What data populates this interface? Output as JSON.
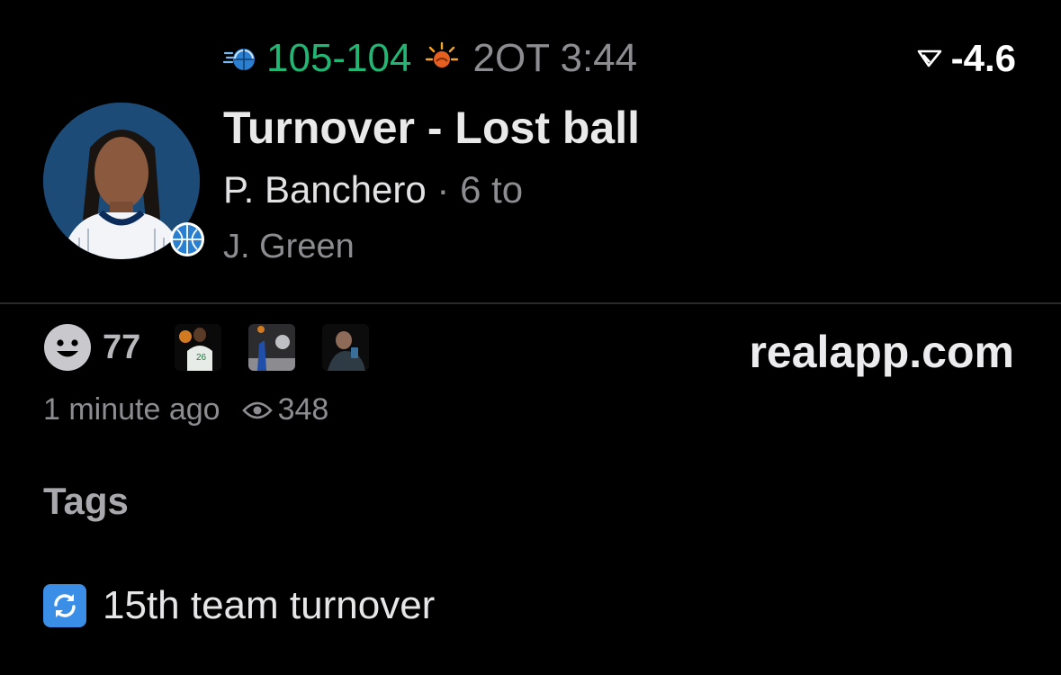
{
  "game": {
    "home_logo": "orlando-magic-logo",
    "score": "105-104",
    "away_logo": "phoenix-suns-logo",
    "clock": "2OT 3:44",
    "spread_icon": "spread-arrow-icon",
    "spread": "-4.6"
  },
  "play": {
    "title": "Turnover - Lost ball",
    "player": "P. Banchero",
    "separator": " · ",
    "count": "6 to",
    "secondary": "J. Green"
  },
  "reactions": {
    "icon": "smiley-icon",
    "count": "77",
    "thumbs": [
      "reaction-thumb-celtics-player",
      "reaction-thumb-shooting-player",
      "reaction-thumb-person-phone"
    ]
  },
  "site": "realapp.com",
  "meta": {
    "time": "1 minute ago",
    "views": "348"
  },
  "tags": {
    "heading": "Tags",
    "items": [
      {
        "icon": "repeat-icon",
        "label": "15th team turnover"
      }
    ]
  },
  "colors": {
    "score_green": "#22b573",
    "muted_gray": "#8c8c91",
    "tag_blue": "#3a8ee6",
    "magic_blue": "#1c4b78"
  }
}
